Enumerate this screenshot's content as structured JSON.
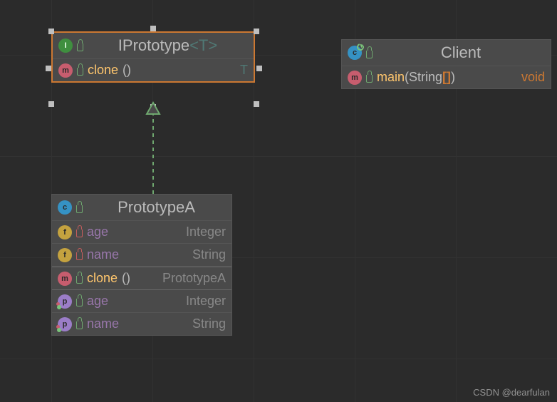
{
  "watermark": "CSDN @dearfulan",
  "iprototype": {
    "title_prefix": "IPrototype",
    "title_generic": "<T>",
    "method": {
      "name": "clone",
      "parens": "()",
      "return": "T"
    }
  },
  "client": {
    "title": "Client",
    "method": {
      "name": "main",
      "openParen": "(",
      "paramType": "String",
      "brackets": "[]",
      "closeParen": ")",
      "return": "void"
    }
  },
  "prototypeA": {
    "title": "PrototypeA",
    "fields": [
      {
        "name": "age",
        "type": "Integer"
      },
      {
        "name": "name",
        "type": "String"
      }
    ],
    "method": {
      "name": "clone",
      "parens": "()",
      "return": "PrototypeA"
    },
    "props": [
      {
        "name": "age",
        "type": "Integer"
      },
      {
        "name": "name",
        "type": "String"
      }
    ]
  }
}
